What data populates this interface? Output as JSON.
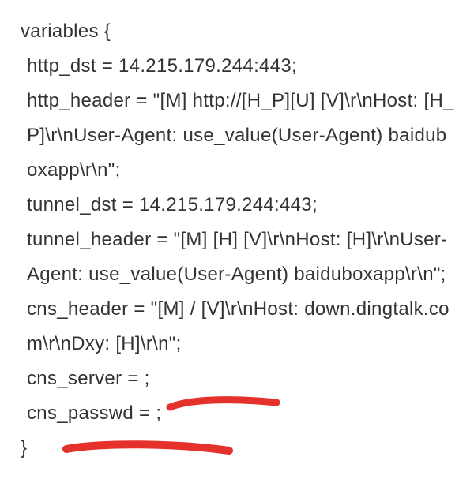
{
  "code": {
    "l1": "variables {",
    "l2": " http_dst = 14.215.179.244:443;",
    "l3": " http_header = \"[M] http://[H_P][U] [V]\\r\\nHost: [H_P]\\r\\nUser-Agent: use_value(User-Agent) baiduboxapp\\r\\n\";",
    "l4": " tunnel_dst = 14.215.179.244:443;",
    "l5": " tunnel_header = \"[M] [H] [V]\\r\\nHost: [H]\\r\\nUser-Agent: use_value(User-Agent) baiduboxapp\\r\\n\"; cns_header = \"[M] / [V]\\r\\nHost: down.dingtalk.com\\r\\nDxy: [H]\\r\\n\";",
    "l6": " cns_server = ;",
    "l7": " cns_passwd = ;",
    "l8": "}"
  },
  "annotation_color": "#e4312b"
}
